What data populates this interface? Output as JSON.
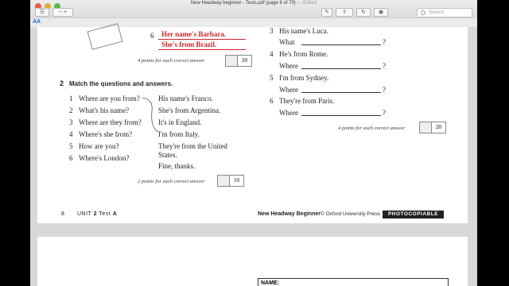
{
  "window": {
    "title": "New Headway beginner - Tests.pdf (page 8 of 79)",
    "title_edited": "— Edited"
  },
  "toolbar": {
    "search_placeholder": "Search",
    "aa_label": "AA"
  },
  "page": {
    "top_answers": {
      "num6": "6",
      "line1": "Her name's Barbara.",
      "line2": "She's from Brazil."
    },
    "score1": {
      "label": "4 points for each correct answer",
      "value": "20"
    },
    "ex2": {
      "num": "2",
      "heading": "Match the questions and answers.",
      "questions": [
        {
          "n": "1",
          "q": "Where are you from?"
        },
        {
          "n": "2",
          "q": "What's his name?"
        },
        {
          "n": "3",
          "q": "Where are they from?"
        },
        {
          "n": "4",
          "q": "Where's she from?"
        },
        {
          "n": "5",
          "q": "How are you?"
        },
        {
          "n": "6",
          "q": "Where's London?"
        }
      ],
      "answers": [
        "His name's Franco.",
        "She's from Argentina.",
        "It's in England.",
        "I'm from Italy.",
        "They're from the United",
        "States.",
        "Fine, thanks."
      ]
    },
    "score2": {
      "label": "2 points for each correct answer",
      "value": "10"
    },
    "right_col": {
      "items": [
        {
          "n": "3",
          "text": "His name's Luca.",
          "prompt": "What",
          "q": "?"
        },
        {
          "n": "4",
          "text": "He's from Rome.",
          "prompt": "Where",
          "q": "?"
        },
        {
          "n": "5",
          "text": "I'm from Sydney.",
          "prompt": "Where",
          "q": "?"
        },
        {
          "n": "6",
          "text": "They're from Paris.",
          "prompt": "Where",
          "q": "?"
        }
      ]
    },
    "score3": {
      "label": "4 points for each correct answer",
      "value": "20"
    },
    "footer": {
      "page_num": "8",
      "unit": "UNIT",
      "unit_num": "2",
      "test": "Test",
      "test_letter": "A",
      "book": "New Headway Beginner",
      "copyright": "© Oxford University Press",
      "photocopiable": "PHOTOCOPIABLE"
    }
  },
  "page2": {
    "name_label": "NAME:"
  }
}
